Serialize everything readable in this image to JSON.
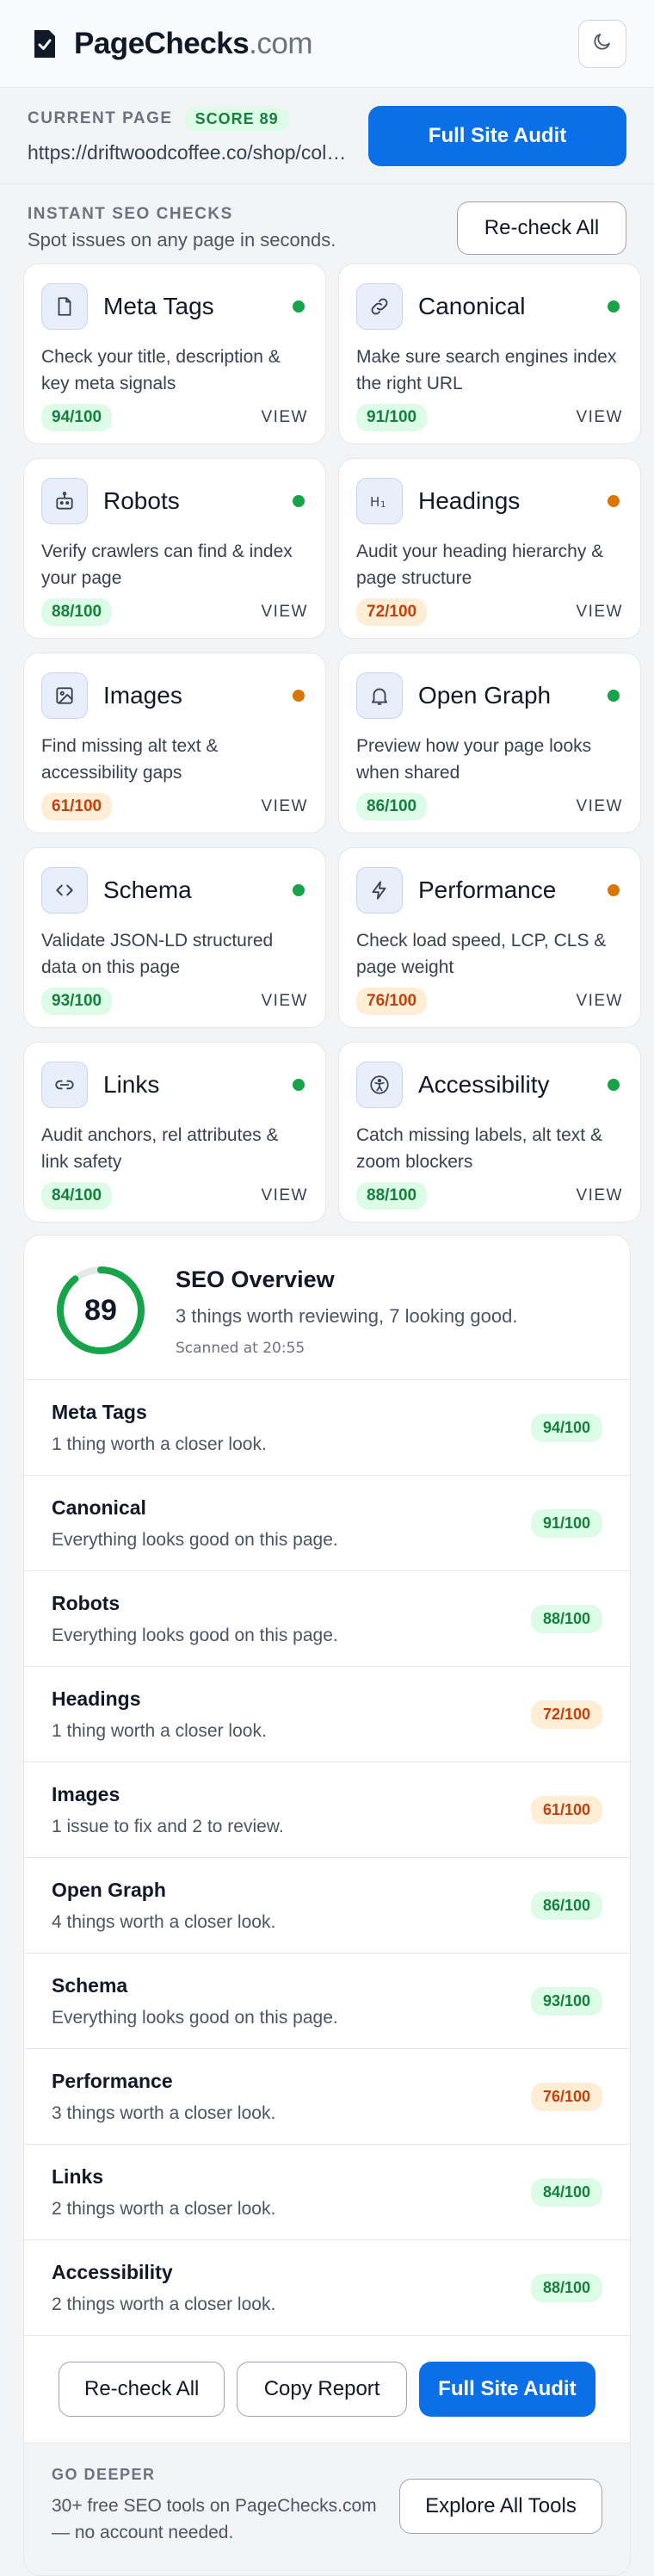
{
  "header": {
    "brand_name": "PageChecks",
    "brand_tld": ".com",
    "icons": {
      "logo": "page-check-logo-icon",
      "theme": "moon-icon"
    }
  },
  "current_page": {
    "label": "CURRENT PAGE",
    "score_label": "SCORE 89",
    "url": "https://driftwoodcoffee.co/shop/cold-brew",
    "audit_button": "Full Site Audit"
  },
  "instant": {
    "title": "INSTANT SEO CHECKS",
    "subtitle": "Spot issues on any page in seconds.",
    "recheck_button": "Re-check All",
    "view_label": "VIEW"
  },
  "cards": [
    {
      "title": "Meta Tags",
      "icon": "document-icon",
      "desc": "Check your title, description & key meta signals",
      "score": "94/100",
      "status": "good"
    },
    {
      "title": "Canonical",
      "icon": "link-icon",
      "desc": "Make sure search engines index the right URL",
      "score": "91/100",
      "status": "good"
    },
    {
      "title": "Robots",
      "icon": "robot-icon",
      "desc": "Verify crawlers can find & index your page",
      "score": "88/100",
      "status": "good"
    },
    {
      "title": "Headings",
      "icon": "heading-icon",
      "desc": "Audit your heading hierarchy & page structure",
      "score": "72/100",
      "status": "warn"
    },
    {
      "title": "Images",
      "icon": "image-icon",
      "desc": "Find missing alt text & accessibility gaps",
      "score": "61/100",
      "status": "warn"
    },
    {
      "title": "Open Graph",
      "icon": "bell-icon",
      "desc": "Preview how your page looks when shared",
      "score": "86/100",
      "status": "good"
    },
    {
      "title": "Schema",
      "icon": "code-icon",
      "desc": "Validate JSON-LD structured data on this page",
      "score": "93/100",
      "status": "good"
    },
    {
      "title": "Performance",
      "icon": "bolt-icon",
      "desc": "Check load speed, LCP, CLS & page weight",
      "score": "76/100",
      "status": "warn"
    },
    {
      "title": "Links",
      "icon": "chain-link-icon",
      "desc": "Audit anchors, rel attributes & link safety",
      "score": "84/100",
      "status": "good"
    },
    {
      "title": "Accessibility",
      "icon": "accessibility-icon",
      "desc": "Catch missing labels, alt text & zoom blockers",
      "score": "88/100",
      "status": "good"
    }
  ],
  "overview": {
    "score": "89",
    "score_value": 89,
    "title": "SEO Overview",
    "summary": "3 things worth reviewing, 7 looking good.",
    "scanned": "Scanned at 20:55",
    "rows": [
      {
        "title": "Meta Tags",
        "sub": "1 thing worth a closer look.",
        "score": "94/100",
        "status": "good"
      },
      {
        "title": "Canonical",
        "sub": "Everything looks good on this page.",
        "score": "91/100",
        "status": "good"
      },
      {
        "title": "Robots",
        "sub": "Everything looks good on this page.",
        "score": "88/100",
        "status": "good"
      },
      {
        "title": "Headings",
        "sub": "1 thing worth a closer look.",
        "score": "72/100",
        "status": "warn"
      },
      {
        "title": "Images",
        "sub": "1 issue to fix and 2 to review.",
        "score": "61/100",
        "status": "warn"
      },
      {
        "title": "Open Graph",
        "sub": "4 things worth a closer look.",
        "score": "86/100",
        "status": "good"
      },
      {
        "title": "Schema",
        "sub": "Everything looks good on this page.",
        "score": "93/100",
        "status": "good"
      },
      {
        "title": "Performance",
        "sub": "3 things worth a closer look.",
        "score": "76/100",
        "status": "warn"
      },
      {
        "title": "Links",
        "sub": "2 things worth a closer look.",
        "score": "84/100",
        "status": "good"
      },
      {
        "title": "Accessibility",
        "sub": "2 things worth a closer look.",
        "score": "88/100",
        "status": "good"
      }
    ],
    "actions": {
      "recheck": "Re-check All",
      "copy": "Copy Report",
      "audit": "Full Site Audit"
    }
  },
  "deeper": {
    "label": "GO DEEPER",
    "text": "30+ free SEO tools on PageChecks.com — no account needed.",
    "button": "Explore All Tools"
  },
  "colors": {
    "primary": "#0b6fe8",
    "good": "#16a34a",
    "warn": "#d97706"
  }
}
